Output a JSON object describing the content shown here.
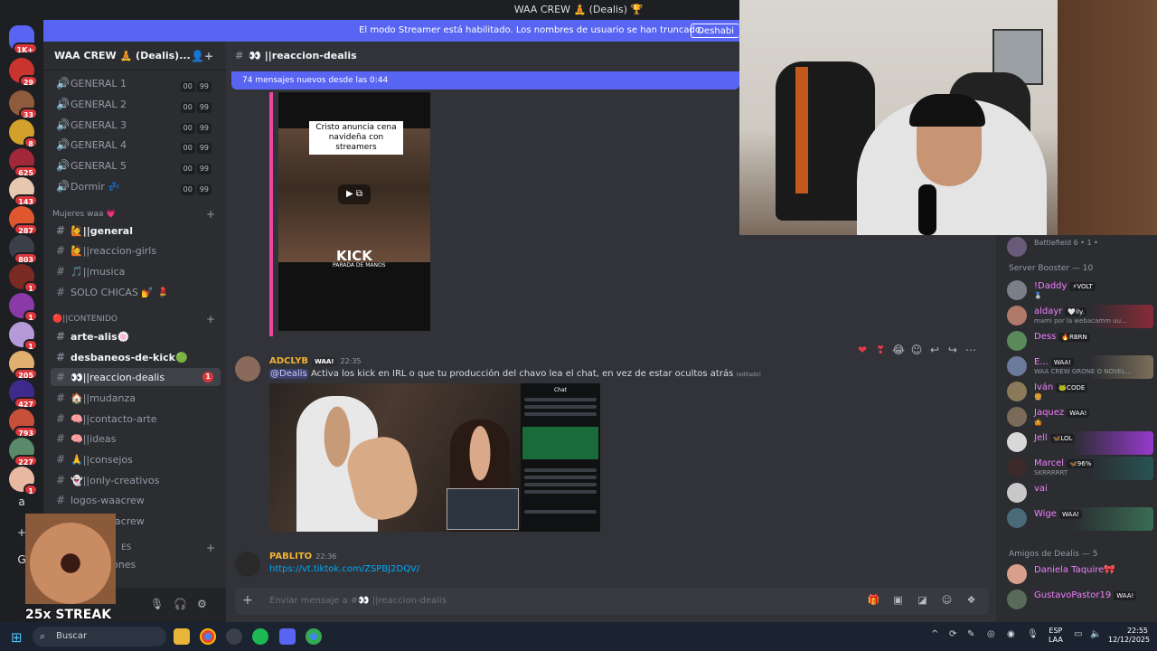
{
  "window": {
    "title": "WAA CREW 🧘 (Dealis) 🏆"
  },
  "banner": {
    "text": "El modo Streamer está habilitado. Los nombres de usuario se han truncado.",
    "button": "Deshabi"
  },
  "rail": {
    "badges": [
      "1K+",
      "29",
      "33",
      "8",
      "625",
      "143",
      "287",
      "803",
      "1",
      "1",
      "1",
      "205",
      "427",
      "793",
      "227",
      "1"
    ],
    "letter": "a",
    "letter2": "G"
  },
  "sidebar": {
    "guild_name": "WAA CREW 🧘 (Dealis)...",
    "voice_channels": [
      {
        "label": "GENERAL 1",
        "c1": "00",
        "c2": "99"
      },
      {
        "label": "GENERAL 2",
        "c1": "00",
        "c2": "99"
      },
      {
        "label": "GENERAL 3",
        "c1": "00",
        "c2": "99"
      },
      {
        "label": "GENERAL 4",
        "c1": "00",
        "c2": "99"
      },
      {
        "label": "GENERAL 5",
        "c1": "00",
        "c2": "99"
      },
      {
        "label": "Dormir 💤",
        "c1": "00",
        "c2": "99"
      }
    ],
    "category1": "Mujeres waa 💗",
    "cat1_channels": [
      "🙋||general",
      "🙋||reaccion-girls",
      "🎵||musica",
      "SOLO CHICAS 💅 💄"
    ],
    "category2": "🔴||CONTENIDO",
    "cat2_channels": [
      "arte-alis🍥",
      "desbaneos-de-kick🟢",
      "👀||reaccion-dealis",
      "🏠||mudanza",
      "🧠||contacto-arte",
      "🧠||ideas",
      "🙏||consejos",
      "👻||only-creativos",
      "logos-waacrew",
      "logos-waacrew"
    ],
    "unread_count": "1",
    "category3": "ES",
    "cat3_channel": "ones"
  },
  "streak": {
    "text": "25x STREAK"
  },
  "chat": {
    "channel_name": "👀 ||reaccion-dealis",
    "new_messages": "74 mensajes nuevos desde las 0:44",
    "embed": {
      "title": "Cristo anuncia cena navideña con streamers",
      "brand": "KICK",
      "brand_sub": "PARADA DE MANOS"
    },
    "message1": {
      "author": "ADCLYB",
      "tag": "WAA!",
      "time": "22:35",
      "mention": "@Dealis",
      "text": "Activa los kick en IRL o que tu producción del chavo lea el chat, en vez de estar ocultos atrás",
      "edited": "(editado)"
    },
    "attachment": {
      "chat_header": "Chat"
    },
    "message2": {
      "author": "PABLITO",
      "time": "22:36",
      "link": "https://vt.tiktok.com/ZSPBJ2DQV/"
    },
    "composer_placeholder": "Enviar mensaje a #👀 ||reaccion-dealis"
  },
  "members": {
    "top_row": {
      "name": "Battlefield 6 • 1 •"
    },
    "boosters_header": "Server Booster — 10",
    "boosters": [
      {
        "name": "!Daddy",
        "tag": "⚡VOLT",
        "sub": "🥈",
        "color": "#f47fff"
      },
      {
        "name": "aldayr",
        "tag": "🤍ily.",
        "sub": "mami por la webacamm uu...",
        "color": "#f47fff"
      },
      {
        "name": "Dess",
        "tag": "🔥RBRN",
        "sub": "",
        "color": "#f47fff"
      },
      {
        "name": "E...",
        "tag": "WAA!",
        "sub": "WAA CREW GRONE O NOVEL...",
        "color": "#f47fff"
      },
      {
        "name": "Iván",
        "tag": "🐸CODE",
        "sub": "🍔",
        "color": "#f47fff"
      },
      {
        "name": "Jaquez",
        "tag": "WAA!",
        "sub": "🤷",
        "color": "#f47fff"
      },
      {
        "name": "Jell",
        "tag": "🦋LOL",
        "sub": "",
        "color": "#f47fff"
      },
      {
        "name": "Marcel",
        "tag": "🦋96%",
        "sub": "SKRRRRRT",
        "color": "#f47fff"
      },
      {
        "name": "vai",
        "tag": "",
        "sub": "",
        "color": "#f47fff"
      },
      {
        "name": "Wige",
        "tag": "WAA!",
        "sub": "",
        "color": "#f47fff"
      }
    ],
    "friends_header": "Amigos de Dealis — 5",
    "friends": [
      {
        "name": "Daniela Taquire🎀",
        "tag": "",
        "color": "#f47fff"
      },
      {
        "name": "GustavoPastor19",
        "tag": "WAA!",
        "color": "#f47fff"
      }
    ]
  },
  "taskbar": {
    "search": "Buscar",
    "lang1": "ESP",
    "lang2": "LAA",
    "time": "22:55",
    "date": "12/12/2025"
  }
}
